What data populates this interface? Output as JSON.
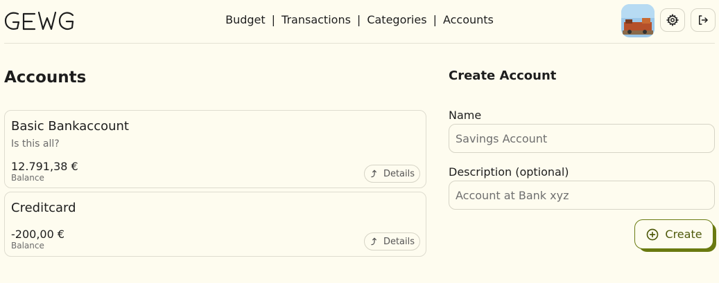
{
  "app": {
    "logo_text": "GEWG"
  },
  "nav": {
    "items": [
      {
        "label": "Budget"
      },
      {
        "label": "Transactions"
      },
      {
        "label": "Categories"
      },
      {
        "label": "Accounts"
      }
    ],
    "separator": "|"
  },
  "header_icons": {
    "settings": "gear-icon",
    "logout": "logout-icon"
  },
  "accounts": {
    "title": "Accounts",
    "items": [
      {
        "name": "Basic Bankaccount",
        "description": "Is this all?",
        "balance": "12.791,38 €",
        "balance_label": "Balance",
        "details_label": "Details"
      },
      {
        "name": "Creditcard",
        "description": "",
        "balance": "-200,00 €",
        "balance_label": "Balance",
        "details_label": "Details"
      }
    ]
  },
  "create_form": {
    "title": "Create Account",
    "name_label": "Name",
    "name_placeholder": "Savings Account",
    "description_label": "Description (optional)",
    "description_placeholder": "Account at Bank xyz",
    "submit_label": "Create"
  },
  "colors": {
    "background": "#fefcef",
    "accent": "#6a7a10",
    "border": "#d6d4c6"
  }
}
